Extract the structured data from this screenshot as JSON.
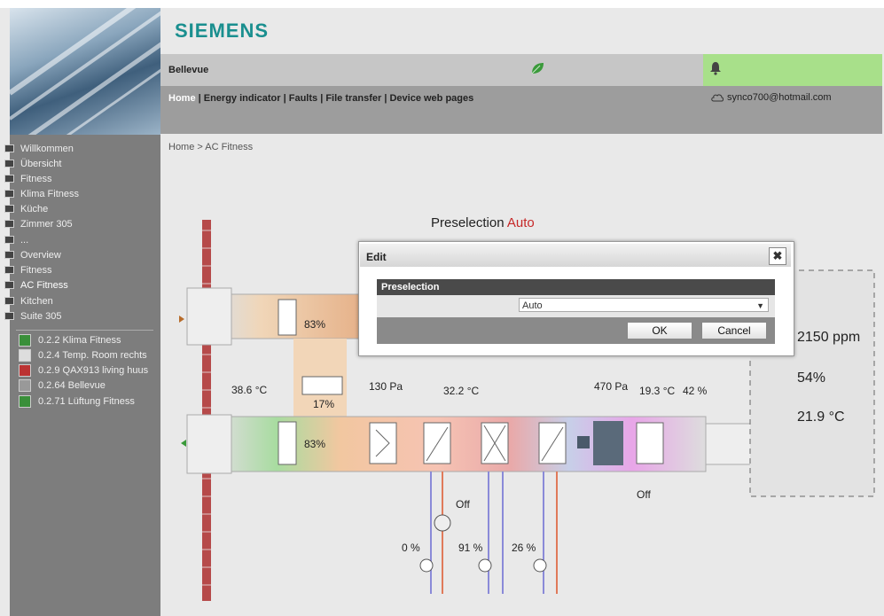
{
  "brand": "SIEMENS",
  "plant": {
    "name": "Bellevue"
  },
  "nav": {
    "home": "Home",
    "rest": " | Energy indicator | Faults | File transfer | Device web pages"
  },
  "user": {
    "email": "synco700@hotmail.com"
  },
  "sidebar": {
    "items": [
      {
        "label": "Willkommen"
      },
      {
        "label": "Übersicht"
      },
      {
        "label": "Fitness"
      },
      {
        "label": "Klima Fitness"
      },
      {
        "label": "Küche"
      },
      {
        "label": "Zimmer 305"
      },
      {
        "label": "..."
      },
      {
        "label": "Overview"
      },
      {
        "label": "Fitness"
      },
      {
        "label": "AC Fitness"
      },
      {
        "label": "Kitchen"
      },
      {
        "label": "Suite 305"
      }
    ],
    "devices": [
      {
        "label": "0.2.2 Klima Fitness"
      },
      {
        "label": "0.2.4 Temp. Room rechts"
      },
      {
        "label": "0.2.9 QAX913 living huus"
      },
      {
        "label": "0.2.64 Bellevue"
      },
      {
        "label": "0.2.71 Lüftung Fitness"
      }
    ]
  },
  "breadcrumb": "Home > AC Fitness",
  "preselection": {
    "label": "Preselection",
    "value": "Auto"
  },
  "dialog": {
    "title": "Edit",
    "header": "Preselection",
    "selected": "Auto",
    "ok": "OK",
    "cancel": "Cancel",
    "close": "✖"
  },
  "diagram": {
    "damper_top": "83%",
    "damper_bottom": "83%",
    "recirc_damper": "17%",
    "outside_temp": "38.6 °C",
    "filter_pressure": "130 Pa",
    "supply_pre_temp": "32.2 °C",
    "fan_pressure": "470 Pa",
    "supply_temp": "19.3 °C",
    "supply_humidity": "42 %",
    "room_co2": "2150 ppm",
    "room_humidity": "54%",
    "room_temp": "21.9 °C",
    "pump_state": "Off",
    "humidifier_state": "Off",
    "valve1": "0 %",
    "valve2": "91 %",
    "valve3": "26 %"
  }
}
